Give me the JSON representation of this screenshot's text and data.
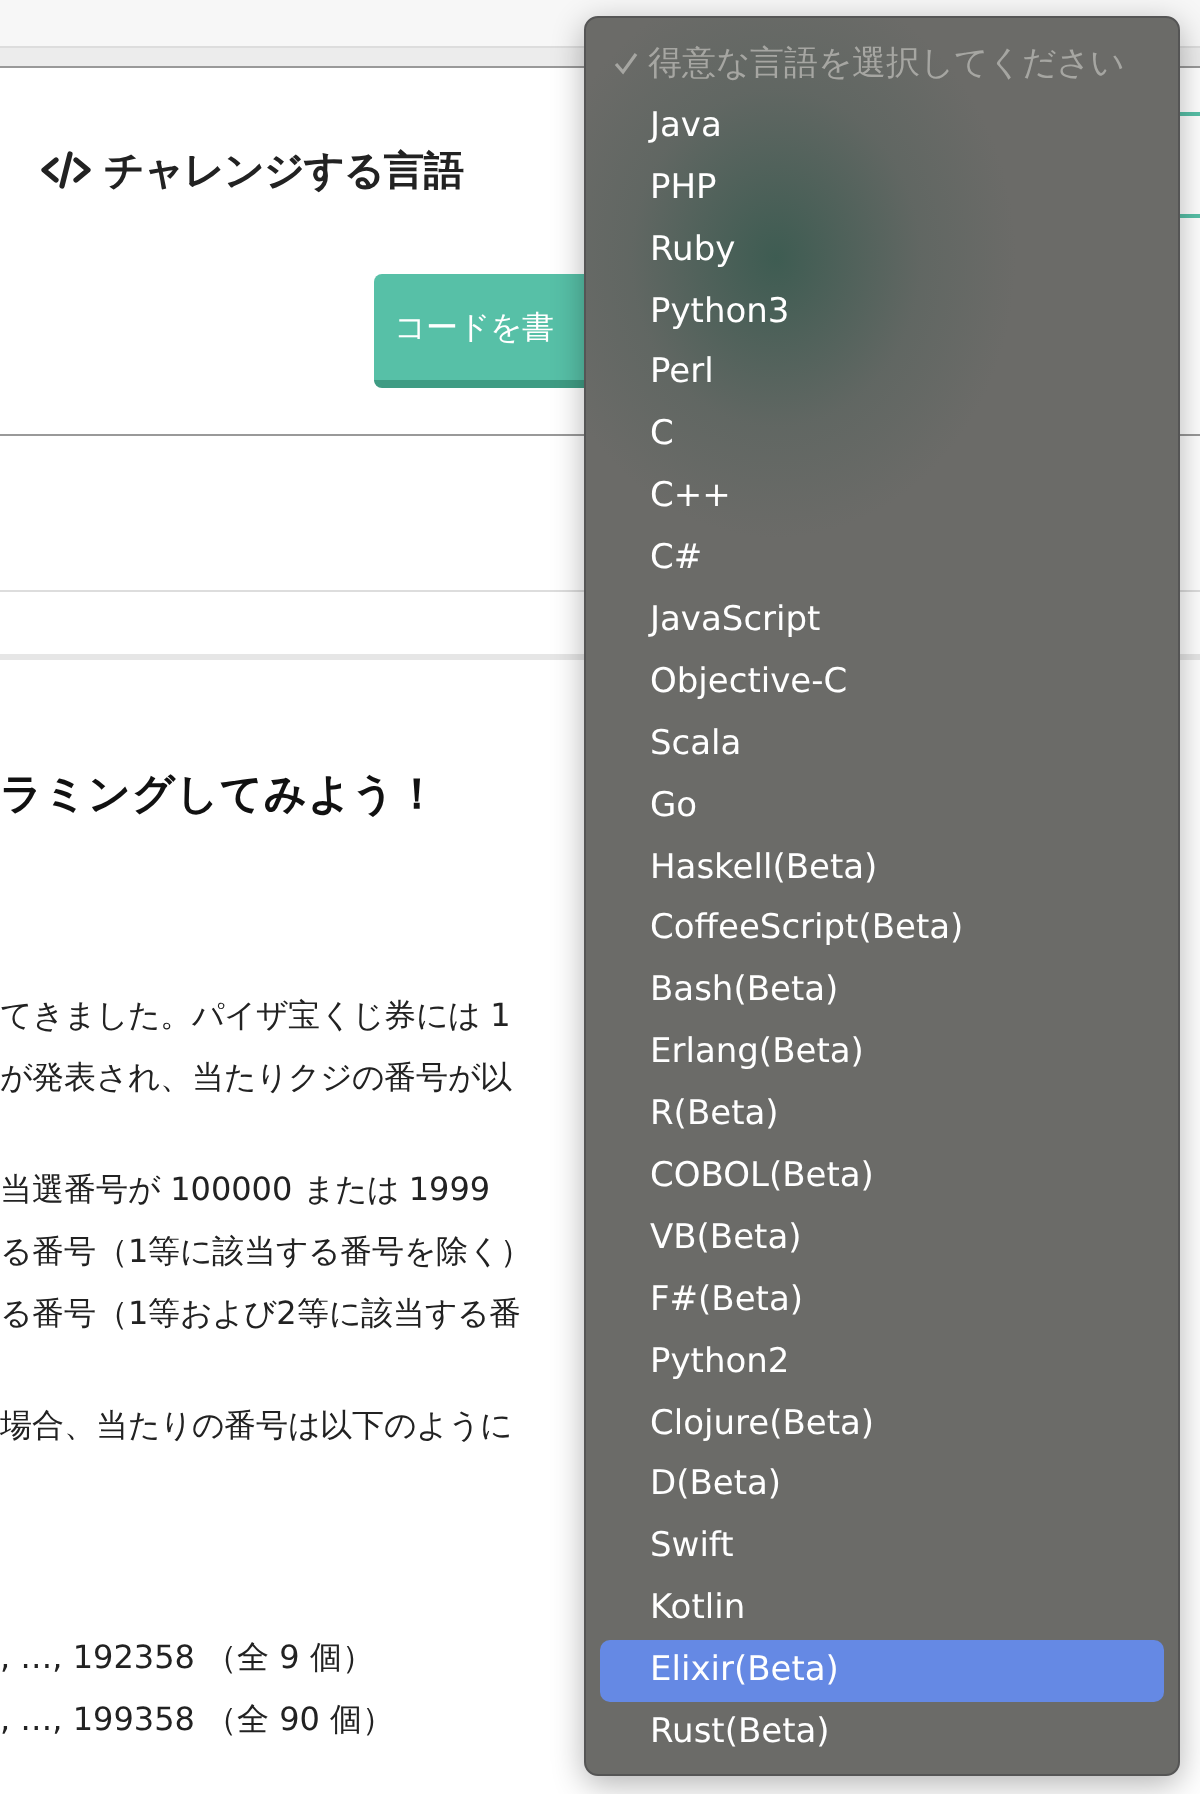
{
  "section": {
    "title": "チャレンジする言語",
    "button": "コードを書"
  },
  "content": {
    "heading": "ラミングしてみよう！",
    "paragraphs": [
      [
        "てきました。パイザ宝くじ券には 1",
        "が発表され、当たりクジの番号が以"
      ],
      [
        "当選番号が 100000 または 1999",
        "る番号（1等に該当する番号を除く）",
        "る番号（1等および2等に該当する番"
      ],
      [
        "場合、当たりの番号は以下のように"
      ]
    ],
    "results": [
      ", …, 192358 （全 9 個）",
      ", …, 199358 （全 90 個）"
    ]
  },
  "dropdown": {
    "items": [
      {
        "label": "得意な言語を選択してください",
        "checked": true,
        "disabled": true,
        "selected": false
      },
      {
        "label": "Java",
        "checked": false,
        "disabled": false,
        "selected": false
      },
      {
        "label": "PHP",
        "checked": false,
        "disabled": false,
        "selected": false
      },
      {
        "label": "Ruby",
        "checked": false,
        "disabled": false,
        "selected": false
      },
      {
        "label": "Python3",
        "checked": false,
        "disabled": false,
        "selected": false
      },
      {
        "label": "Perl",
        "checked": false,
        "disabled": false,
        "selected": false
      },
      {
        "label": "C",
        "checked": false,
        "disabled": false,
        "selected": false
      },
      {
        "label": "C++",
        "checked": false,
        "disabled": false,
        "selected": false
      },
      {
        "label": "C#",
        "checked": false,
        "disabled": false,
        "selected": false
      },
      {
        "label": "JavaScript",
        "checked": false,
        "disabled": false,
        "selected": false
      },
      {
        "label": "Objective-C",
        "checked": false,
        "disabled": false,
        "selected": false
      },
      {
        "label": "Scala",
        "checked": false,
        "disabled": false,
        "selected": false
      },
      {
        "label": "Go",
        "checked": false,
        "disabled": false,
        "selected": false
      },
      {
        "label": "Haskell(Beta)",
        "checked": false,
        "disabled": false,
        "selected": false
      },
      {
        "label": "CoffeeScript(Beta)",
        "checked": false,
        "disabled": false,
        "selected": false
      },
      {
        "label": "Bash(Beta)",
        "checked": false,
        "disabled": false,
        "selected": false
      },
      {
        "label": "Erlang(Beta)",
        "checked": false,
        "disabled": false,
        "selected": false
      },
      {
        "label": "R(Beta)",
        "checked": false,
        "disabled": false,
        "selected": false
      },
      {
        "label": "COBOL(Beta)",
        "checked": false,
        "disabled": false,
        "selected": false
      },
      {
        "label": "VB(Beta)",
        "checked": false,
        "disabled": false,
        "selected": false
      },
      {
        "label": "F#(Beta)",
        "checked": false,
        "disabled": false,
        "selected": false
      },
      {
        "label": "Python2",
        "checked": false,
        "disabled": false,
        "selected": false
      },
      {
        "label": "Clojure(Beta)",
        "checked": false,
        "disabled": false,
        "selected": false
      },
      {
        "label": "D(Beta)",
        "checked": false,
        "disabled": false,
        "selected": false
      },
      {
        "label": "Swift",
        "checked": false,
        "disabled": false,
        "selected": false
      },
      {
        "label": "Kotlin",
        "checked": false,
        "disabled": false,
        "selected": false
      },
      {
        "label": "Elixir(Beta)",
        "checked": false,
        "disabled": false,
        "selected": true
      },
      {
        "label": "Rust(Beta)",
        "checked": false,
        "disabled": false,
        "selected": false
      }
    ]
  }
}
